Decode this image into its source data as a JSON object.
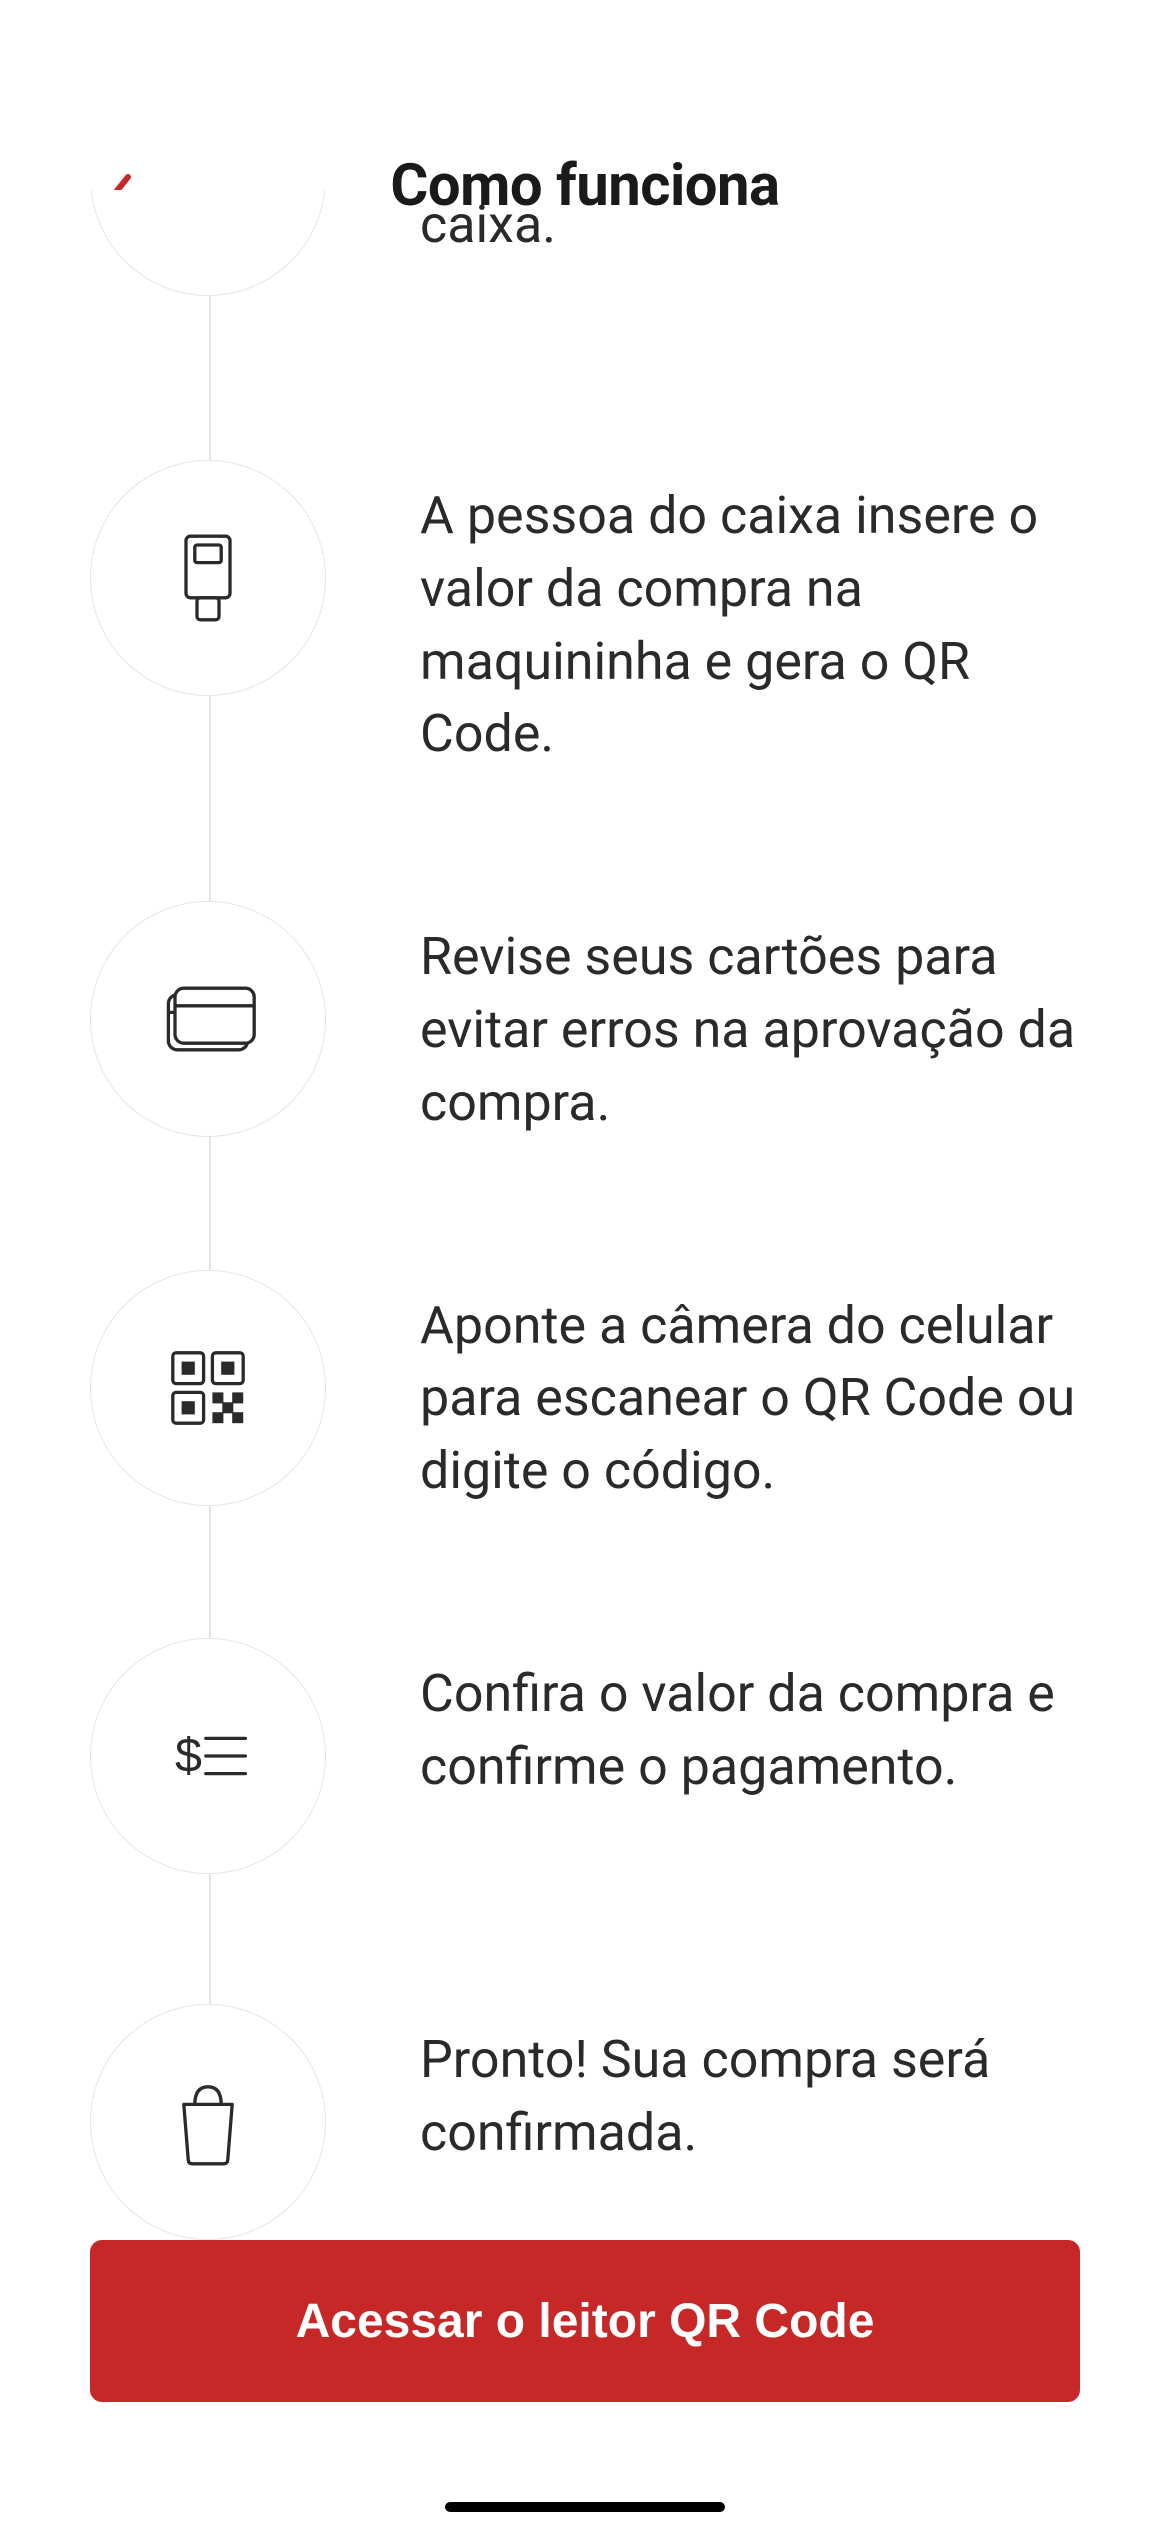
{
  "header": {
    "title": "Como funciona"
  },
  "steps": {
    "partial": "caixa.",
    "pos": "A pessoa do caixa insere o valor da compra na maquininha e gera o QR Code.",
    "card": "Revise seus cartões para evitar erros na aprovação da compra.",
    "qr": "Aponte a câmera do celular para escanear o QR Code ou digite o código.",
    "receipt": "Confira o valor da compra e confirme o pagamento.",
    "bag": "Pronto! Sua compra será confirmada."
  },
  "cta": {
    "label": "Acessar o leitor QR Code"
  },
  "colors": {
    "accent": "#c62828",
    "text": "#2a2a2a",
    "border": "#e5e5e5"
  }
}
